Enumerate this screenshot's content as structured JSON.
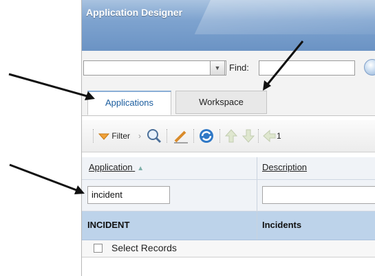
{
  "window": {
    "title": "Application Designer"
  },
  "search": {
    "find_label": "Find:",
    "select_value": "",
    "find_value": ""
  },
  "tabs": [
    {
      "label": "Applications",
      "active": true
    },
    {
      "label": "Workspace",
      "active": false
    }
  ],
  "toolbar": {
    "filter_label": "Filter",
    "page_text": "1"
  },
  "table": {
    "columns": [
      {
        "label": "Application"
      },
      {
        "label": "Description"
      }
    ],
    "filter_values": {
      "application": "incident",
      "description": ""
    },
    "rows": [
      {
        "application": "INCIDENT",
        "description": "Incidents"
      }
    ],
    "select_records_label": "Select Records"
  },
  "annotations": {
    "arrow_color": "#111111",
    "arrow_count": 3
  },
  "colors": {
    "titlebar": "#6b93c4",
    "selected_row": "#bdd3ea",
    "active_tab_text": "#1a5c9e"
  }
}
